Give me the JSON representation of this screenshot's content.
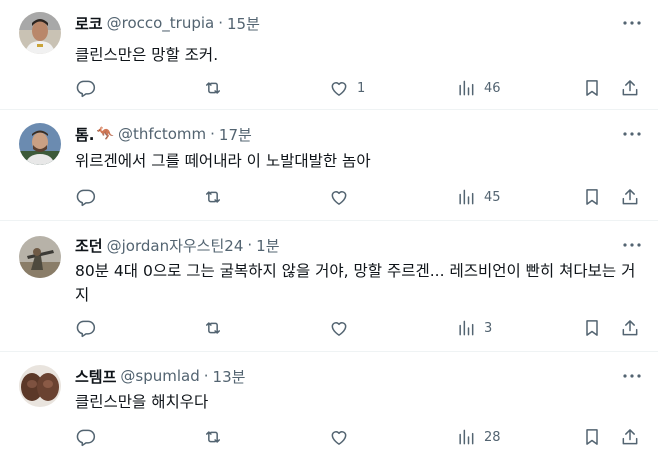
{
  "tweets": [
    {
      "name": "로코",
      "handle": "@rocco_trupia",
      "dot": "·",
      "time": "15분",
      "emoji": "",
      "text": "클린스만은 망할 조커.",
      "replies": "",
      "retweets": "",
      "likes": "1",
      "views": "46"
    },
    {
      "name": "톰.",
      "handle": "@thfctomm",
      "dot": "·",
      "time": "17분",
      "emoji": "🦘",
      "text": "위르겐에서 그를 떼어내라 이 노발대발한 놈아",
      "replies": "",
      "retweets": "",
      "likes": "",
      "views": "45"
    },
    {
      "name": "조던",
      "handle": "@jordan자우스틴24",
      "dot": "·",
      "time": "1분",
      "emoji": "",
      "text": "80분 4대 0으로 그는 굴복하지 않을 거야, 망할 주르겐... 레즈비언이 빤히 쳐다보는 거지",
      "replies": "",
      "retweets": "",
      "likes": "",
      "views": "3"
    },
    {
      "name": "스템프",
      "handle": "@spumlad",
      "dot": "·",
      "time": "13분",
      "emoji": "",
      "text": "클린스만을 해치우다",
      "replies": "",
      "retweets": "",
      "likes": "",
      "views": "28"
    }
  ],
  "icons": {
    "reply": "reply-icon",
    "retweet": "retweet-icon",
    "like": "heart-icon",
    "views": "views-chart-icon",
    "bookmark": "bookmark-icon",
    "share": "share-icon",
    "more": "more-icon"
  },
  "colors": {
    "text": "#0f1419",
    "secondary": "#536471",
    "divider": "#eff3f4"
  }
}
